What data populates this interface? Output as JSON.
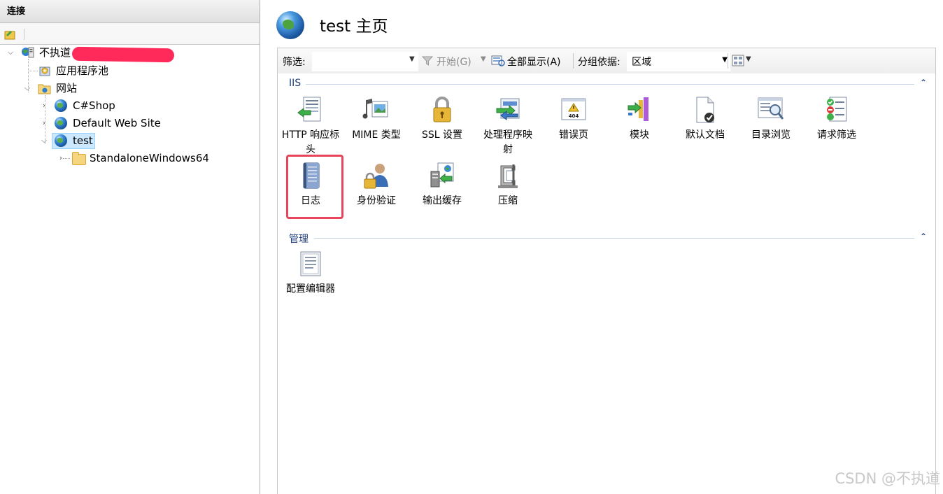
{
  "left": {
    "header": "连接",
    "tree": [
      {
        "label": "不执道",
        "level": 0
      },
      {
        "label": "应用程序池",
        "level": 1
      },
      {
        "label": "网站",
        "level": 1
      },
      {
        "label": "C#Shop",
        "level": 2
      },
      {
        "label": "Default Web Site",
        "level": 2
      },
      {
        "label": "test",
        "level": 2,
        "selected": true
      },
      {
        "label": "StandaloneWindows64",
        "level": 3
      }
    ]
  },
  "title": "test 主页",
  "filterbar": {
    "filter_label": "筛选:",
    "filter_value": "",
    "start_label": "开始(G)",
    "show_all_label": "全部显示(A)",
    "group_by_label": "分组依据:",
    "group_by_value": "区域"
  },
  "groups": [
    {
      "name": "IIS"
    },
    {
      "name": "管理"
    }
  ],
  "features": {
    "http": "HTTP 响应标头",
    "http_line1": "HTTP 响应标",
    "http_line2": "头",
    "mime": "MIME 类型",
    "ssl": "SSL 设置",
    "handler_line1": "处理程序映",
    "handler_line2": "射",
    "errors": "错误页",
    "modules": "模块",
    "default_doc": "默认文档",
    "dir_browse": "目录浏览",
    "request_filter": "请求筛选",
    "logging": "日志",
    "auth": "身份验证",
    "output_cache": "输出缓存",
    "compression": "压缩",
    "config_editor": "配置编辑器",
    "error_badge": "404"
  },
  "watermark": "CSDN @不执道",
  "colors": {
    "highlight": "#e8445a",
    "group_text": "#1f3f7a",
    "selection": "#cce8ff"
  }
}
